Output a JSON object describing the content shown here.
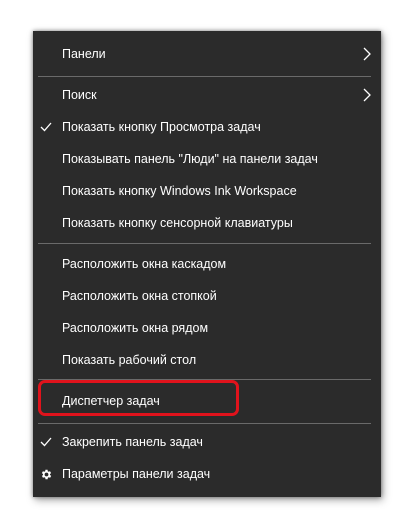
{
  "menu": {
    "items": [
      {
        "label": "Панели",
        "submenu": true
      },
      {
        "label": "Поиск",
        "submenu": true
      },
      {
        "label": "Показать кнопку Просмотра задач",
        "checked": true
      },
      {
        "label": "Показывать панель \"Люди\" на панели задач"
      },
      {
        "label": "Показать кнопку Windows Ink Workspace"
      },
      {
        "label": "Показать кнопку сенсорной клавиатуры"
      },
      {
        "label": "Расположить окна каскадом"
      },
      {
        "label": "Расположить окна стопкой"
      },
      {
        "label": "Расположить окна рядом"
      },
      {
        "label": "Показать рабочий стол"
      },
      {
        "label": "Диспетчер задач",
        "highlighted": true
      },
      {
        "label": "Закрепить панель задач",
        "checked": true
      },
      {
        "label": "Параметры панели задач",
        "icon": "gear-icon"
      }
    ]
  },
  "colors": {
    "menu_background": "#2b2b2b",
    "text": "#ffffff",
    "separator": "#6a6a6a",
    "highlight_outline": "#e0131c"
  }
}
